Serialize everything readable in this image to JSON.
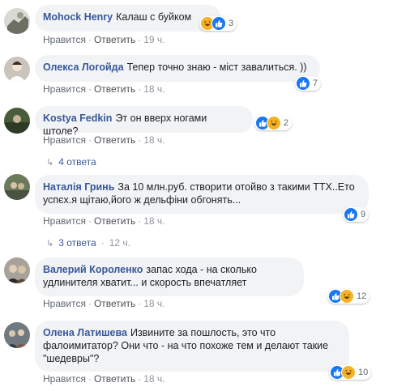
{
  "actions": {
    "like": "Нравится",
    "reply": "Ответить"
  },
  "comments": [
    {
      "author": "Mohock Henry",
      "text": "Калаш с буйком",
      "time": "19 ч.",
      "reactions": [
        "haha",
        "like"
      ],
      "count": "3"
    },
    {
      "author": "Олекса Логойда",
      "text": "Тепер точно знаю - міст завалиться. ))",
      "time": "18 ч.",
      "reactions": [
        "like"
      ],
      "count": "7"
    },
    {
      "author": "Kostya Fedkin",
      "text": "Эт он вверх ногами штоле?",
      "time": "18 ч.",
      "reactions": [
        "like",
        "haha"
      ],
      "count": "2",
      "replies": "4 ответа"
    },
    {
      "author": "Наталія Гринь",
      "text": "За 10 млн.руб. створити отойво з такими ТТХ..Ето успєх.я щітаю,його ж дельфіни обгонять...",
      "time": "18 ч.",
      "reactions": [
        "like"
      ],
      "count": "9",
      "replies": "3 ответа",
      "replies_time": "12 ч."
    },
    {
      "author": "Валерий Короленко",
      "text": "запас хода - на сколько удлинителя хватит... и скорость впечатляет",
      "time": "18 ч.",
      "reactions": [
        "like",
        "haha"
      ],
      "count": "12"
    },
    {
      "author": "Олена Латишева",
      "text": "Извините за пошлость, это что фалоимитатор? Они что - на что похоже тем и делают такие \"шедевры\"?",
      "time": "18 ч.",
      "reactions": [
        "like",
        "haha"
      ],
      "count": "10"
    }
  ],
  "colors": {
    "link": "#385898",
    "bubble": "#f2f3f5",
    "like": "#1877f2",
    "haha": "#f7b125"
  }
}
